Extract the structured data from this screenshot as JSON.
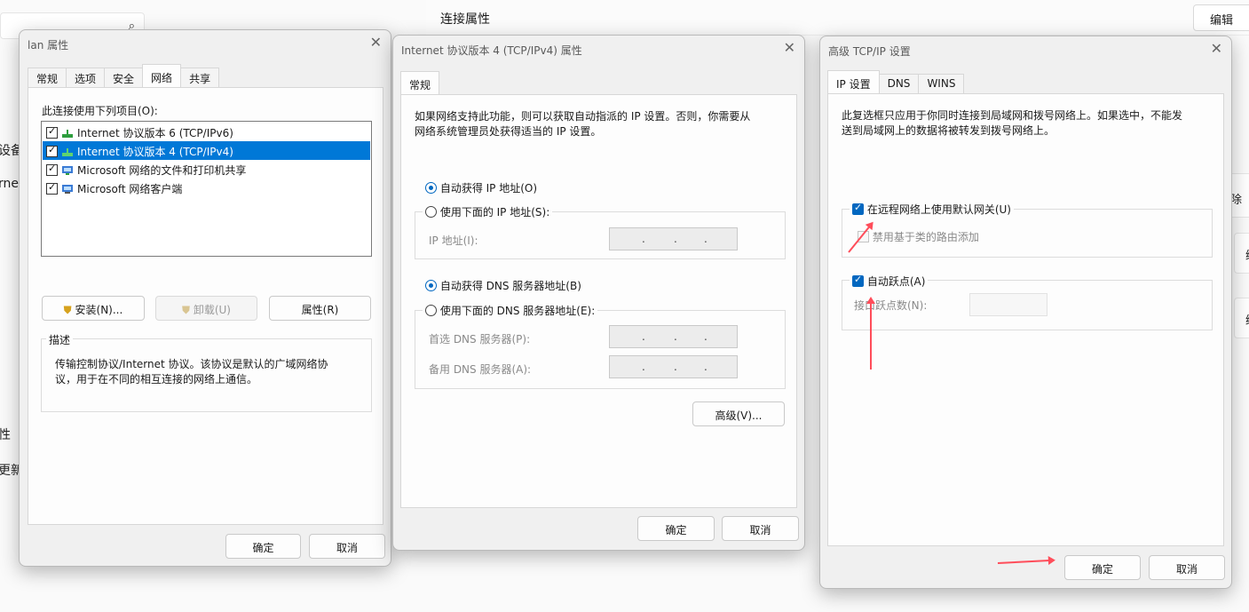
{
  "background": {
    "search_icon": "⌕",
    "side_labels": [
      "设备",
      "rnet",
      "性",
      "更新"
    ],
    "header_title": "连接属性",
    "edit_button": "编辑",
    "right_edge": [
      "除",
      "编",
      "编"
    ]
  },
  "lan_dialog": {
    "title": "lan 属性",
    "close": "✕",
    "tabs": [
      "常规",
      "选项",
      "安全",
      "网络",
      "共享"
    ],
    "active_tab": "网络",
    "list_label": "此连接使用下列项目(O):",
    "items": [
      {
        "label": "Internet 协议版本 6 (TCP/IPv6)",
        "checked": true,
        "icon": "network-protocol-icon"
      },
      {
        "label": "Internet 协议版本 4 (TCP/IPv4)",
        "checked": true,
        "icon": "network-protocol-icon",
        "selected": true
      },
      {
        "label": "Microsoft 网络的文件和打印机共享",
        "checked": true,
        "icon": "network-service-icon"
      },
      {
        "label": "Microsoft 网络客户端",
        "checked": true,
        "icon": "network-client-icon"
      }
    ],
    "install_button": "安装(N)...",
    "uninstall_button": "卸载(U)",
    "properties_button": "属性(R)",
    "description_label": "描述",
    "description_text": "传输控制协议/Internet 协议。该协议是默认的广域网络协议，用于在不同的相互连接的网络上通信。",
    "ok_button": "确定",
    "cancel_button": "取消"
  },
  "ipv4_dialog": {
    "title": "Internet 协议版本 4 (TCP/IPv4) 属性",
    "close": "✕",
    "tab": "常规",
    "intro": "如果网络支持此功能，则可以获取自动指派的 IP 设置。否则，你需要从网络系统管理员处获得适当的 IP 设置。",
    "auto_ip": "自动获得 IP 地址(O)",
    "manual_ip": "使用下面的 IP 地址(S):",
    "ip_label": "IP 地址(I):",
    "auto_dns": "自动获得 DNS 服务器地址(B)",
    "manual_dns": "使用下面的 DNS 服务器地址(E):",
    "preferred_dns": "首选 DNS 服务器(P):",
    "alternate_dns": "备用 DNS 服务器(A):",
    "ip_dots": ".",
    "advanced_button": "高级(V)...",
    "ok_button": "确定",
    "cancel_button": "取消"
  },
  "advanced_dialog": {
    "title": "高级 TCP/IP 设置",
    "close": "✕",
    "tabs": [
      "IP 设置",
      "DNS",
      "WINS"
    ],
    "active_tab": "IP 设置",
    "intro": "此复选框只应用于你同时连接到局域网和拨号网络上。如果选中，不能发送到局域网上的数据将被转发到拨号网络上。",
    "use_default_gateway": "在远程网络上使用默认网关(U)",
    "use_default_gateway_checked": true,
    "disable_class_routes": "禁用基于类的路由添加",
    "disable_class_routes_checked": false,
    "auto_metric": "自动跃点(A)",
    "auto_metric_checked": true,
    "interface_metric": "接口跃点数(N):",
    "ok_button": "确定",
    "cancel_button": "取消"
  },
  "colors": {
    "accent": "#0067c0",
    "selection": "#0078d7",
    "annotation_arrow": "#ff4d5a"
  }
}
